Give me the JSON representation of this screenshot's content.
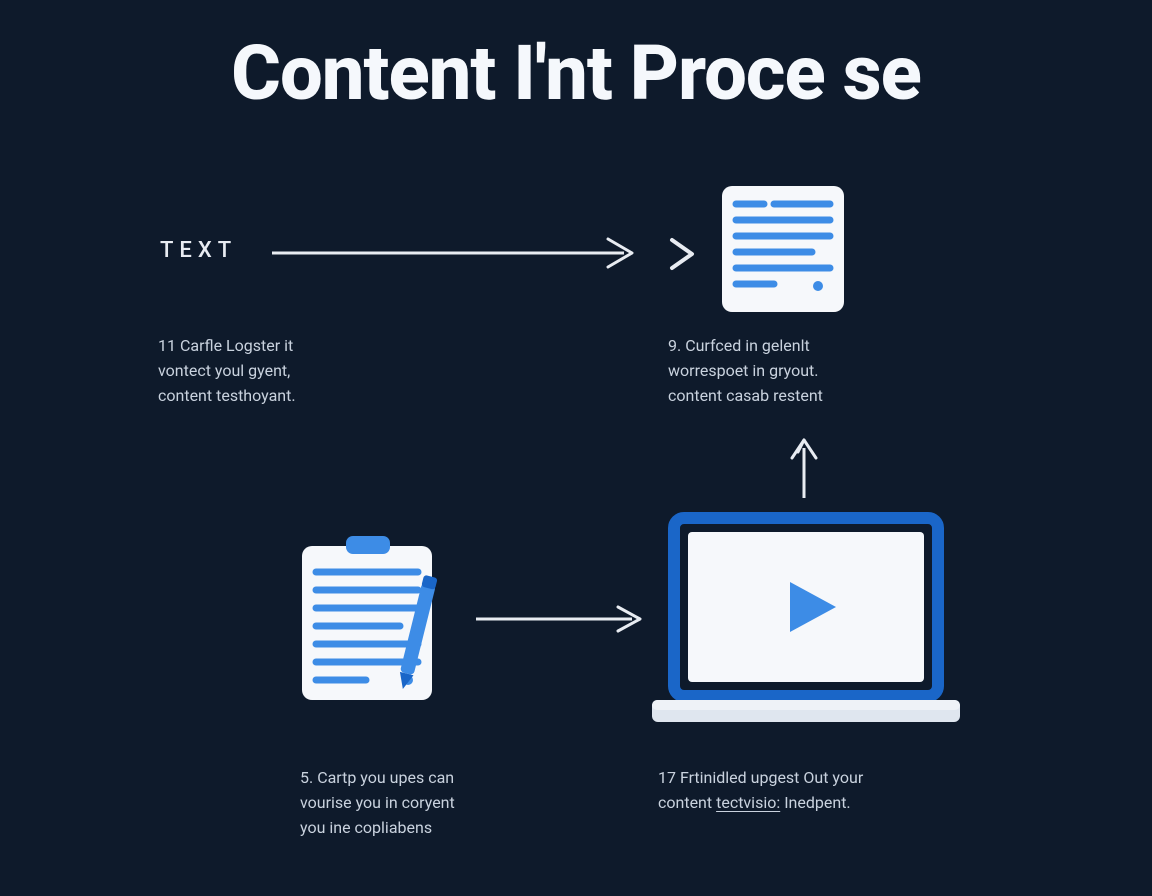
{
  "title": "Content I'nt Proce se",
  "steps": {
    "text_label": "TEXT",
    "step1": {
      "num": "11",
      "line1": "Carfle Logster it",
      "line2": "vontect youl gyent,",
      "line3": "content testhoyant."
    },
    "step2": {
      "num": "9.",
      "line1": "Curfced in gelenlt",
      "line2": "worrespoet in gryout.",
      "line3": "content casab restent"
    },
    "step3": {
      "num": "5.",
      "line1": "Cartp you upes can",
      "line2": "vourise you in coryent",
      "line3": "you ine copliabens"
    },
    "step4": {
      "num": "17",
      "line1": "Frtinidled upgest Out your",
      "line2_a": "content ",
      "line2_link": "tectvisio:",
      "line2_b": " Inedpent."
    }
  },
  "colors": {
    "bg": "#0e1a2b",
    "text": "#e8ecf2",
    "caption": "#c9d2de",
    "accent_blue": "#3d8ce6",
    "accent_blue_dark": "#1a66c8",
    "white": "#f6f8fb"
  }
}
